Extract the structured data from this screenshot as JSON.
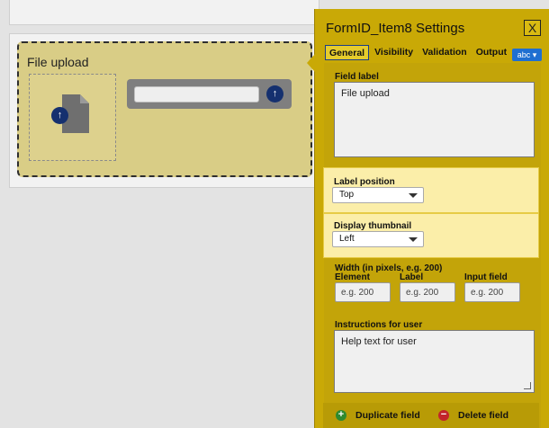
{
  "form": {
    "field_title": "File upload",
    "upload_input_value": ""
  },
  "panel": {
    "title": "FormID_Item8 Settings",
    "close_glyph": "X",
    "tabs": [
      "General",
      "Visibility",
      "Validation",
      "Output"
    ],
    "active_tab": "General",
    "field_type": "abc ▾",
    "field_label_heading": "Field label",
    "field_label_value": "File upload",
    "label_position": {
      "heading": "Label position",
      "value": "Top"
    },
    "display_thumbnail": {
      "heading": "Display thumbnail",
      "value": "Left"
    },
    "width": {
      "heading": "Width (in pixels, e.g. 200)",
      "element_label": "Element",
      "label_label": "Label",
      "input_label": "Input field",
      "element_placeholder": "e.g. 200",
      "label_placeholder": "e.g. 200",
      "input_placeholder": "e.g. 200"
    },
    "instructions": {
      "heading": "Instructions for user",
      "value": "Help text for user"
    },
    "buttons": {
      "duplicate": "Duplicate field",
      "delete": "Delete field"
    }
  },
  "icons": {
    "upload": "upload-arrow-icon",
    "file": "file-icon",
    "close": "close-icon",
    "add": "plus-circle-icon",
    "remove": "minus-circle-icon"
  },
  "colors": {
    "panel": "#c9a906",
    "highlight": "#fbeea9",
    "field_selected": "#d9cd86",
    "accent_blue": "#15306f"
  }
}
